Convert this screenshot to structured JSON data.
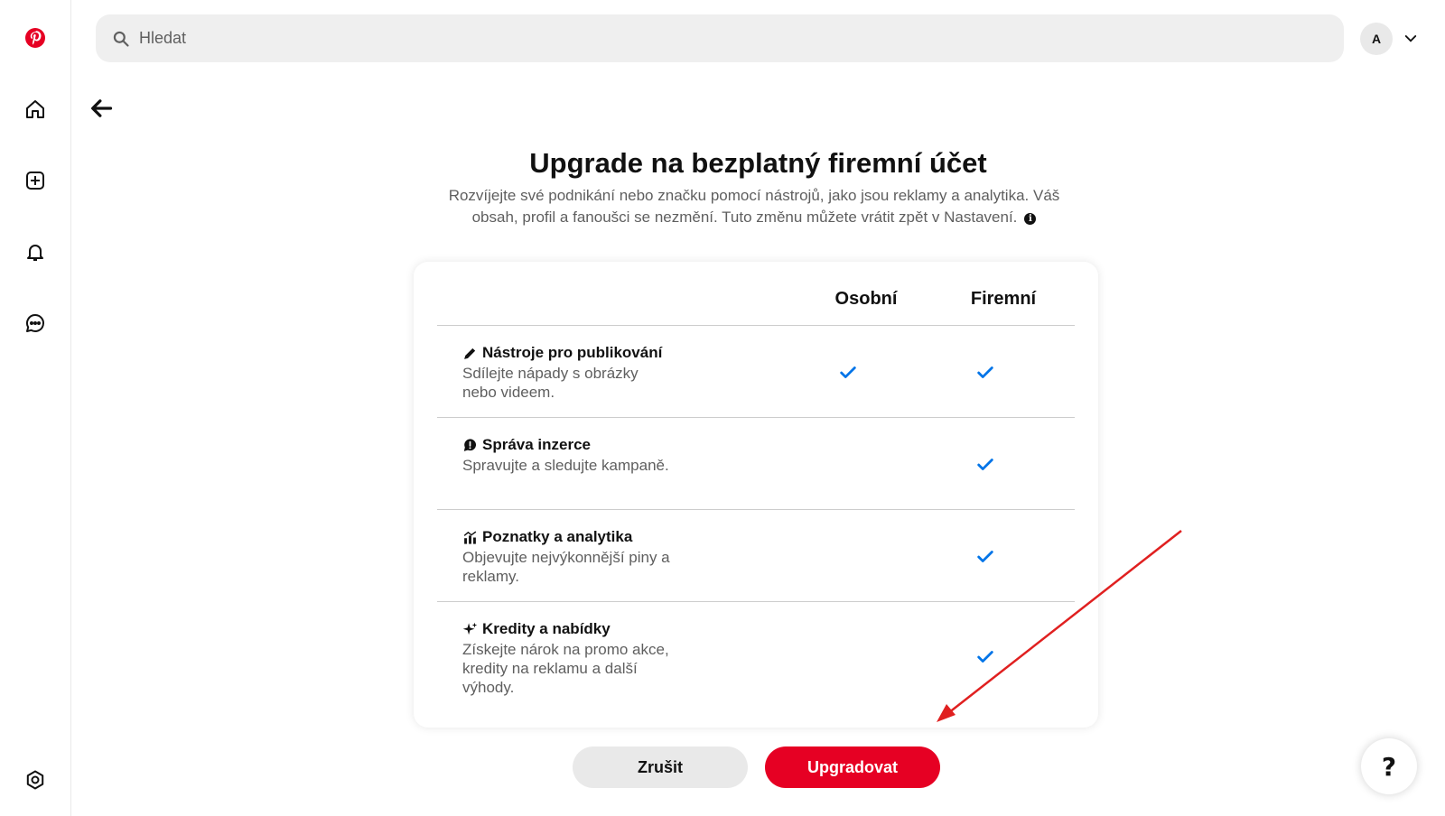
{
  "search": {
    "placeholder": "Hledat"
  },
  "user": {
    "initial": "A"
  },
  "header": {
    "title": "Upgrade na bezplatný firemní účet",
    "subtitle": "Rozvíjejte své podnikání nebo značku pomocí nástrojů, jako jsou reklamy a analytika. Váš obsah, profil a fanoušci se nezmění. Tuto změnu můžete vrátit zpět v Nastavení."
  },
  "table": {
    "columns": [
      "Osobní",
      "Firemní"
    ],
    "rows": [
      {
        "title": "Nástroje pro publikování",
        "description": "Sdílejte nápady s obrázky nebo videem.",
        "icon": "pencil-icon",
        "personal": true,
        "business": true
      },
      {
        "title": "Správa inzerce",
        "description": "Spravujte a sledujte kampaně.",
        "icon": "speech-bubble-icon",
        "personal": false,
        "business": true
      },
      {
        "title": "Poznatky a analytika",
        "description": "Objevujte nejvýkonnější piny a reklamy.",
        "icon": "analytics-icon",
        "personal": false,
        "business": true
      },
      {
        "title": "Kredity a nabídky",
        "description": "Získejte nárok na promo akce, kredity na reklamu a další výhody.",
        "icon": "sparkle-icon",
        "personal": false,
        "business": true
      }
    ]
  },
  "buttons": {
    "cancel": "Zrušit",
    "upgrade": "Upgradovat"
  },
  "help": {
    "label": "?"
  },
  "colors": {
    "brand_red": "#e60023",
    "check_blue": "#0074e8",
    "annotation_arrow": "#e02020"
  }
}
